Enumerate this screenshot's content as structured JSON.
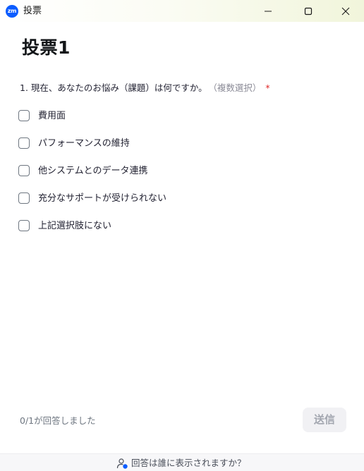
{
  "window": {
    "app_icon_text": "zm",
    "title": "投票"
  },
  "poll": {
    "title": "投票1",
    "question": {
      "text": "1. 現在、あなたのお悩み（課題）は何ですか。",
      "hint": "（複数選択）",
      "required_mark": "*"
    },
    "options": [
      {
        "label": "費用面",
        "checked": false
      },
      {
        "label": "パフォーマンスの維持",
        "checked": false
      },
      {
        "label": "他システムとのデータ連携",
        "checked": false
      },
      {
        "label": "充分なサポートが受けられない",
        "checked": false
      },
      {
        "label": "上記選択肢にない",
        "checked": false
      }
    ]
  },
  "footer": {
    "response_count": "0/1が回答しました",
    "submit_label": "送信",
    "visibility_link": "回答は誰に表示されますか？"
  },
  "colors": {
    "accent": "#0b5cff",
    "required": "#e02828",
    "submit_disabled_bg": "#f1f1f4",
    "submit_disabled_text": "#a3a7b0"
  },
  "icons": {
    "app": "zoom-logo-icon",
    "minimize": "minimize-icon",
    "maximize": "maximize-icon",
    "close": "close-icon",
    "visibility": "person-info-icon"
  }
}
